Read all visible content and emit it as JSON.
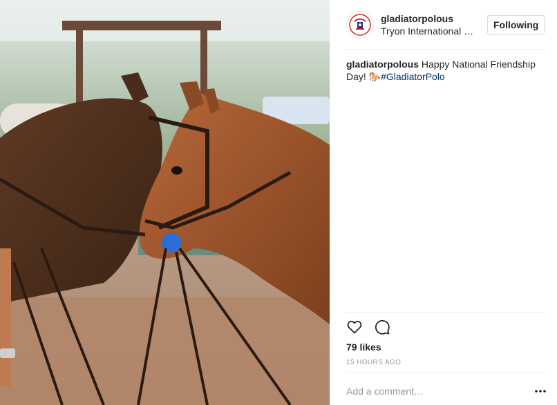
{
  "post": {
    "image_alt": "Two horses in bridles touching heads",
    "username": "gladiatorpolous",
    "location": "Tryon International Equestrian Center",
    "follow_label": "Following",
    "avatar_label": "GLADIATOR"
  },
  "caption": {
    "username": "gladiatorpolous",
    "text": " Happy National Friendship Day! 🐎",
    "hashtag": "#GladiatorPolo"
  },
  "actions": {
    "like_icon": "heart-icon",
    "comment_icon": "comment-bubble-icon"
  },
  "stats": {
    "likes": "79 likes",
    "timestamp": "15 HOURS AGO"
  },
  "comment": {
    "placeholder": "Add a comment…",
    "more_icon": "more-options-icon"
  },
  "colors": {
    "hashtag": "#003569",
    "divider": "#efefef",
    "muted": "#999999",
    "text": "#262626"
  }
}
